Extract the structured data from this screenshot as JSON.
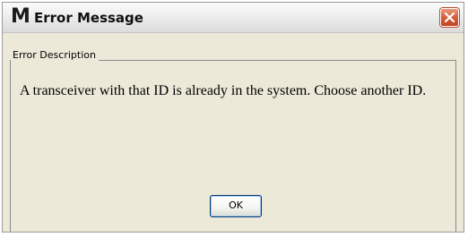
{
  "window": {
    "app_logo": "M",
    "title": "Error Message"
  },
  "group": {
    "legend": "Error Description"
  },
  "message": "A transceiver with that ID is already in the system. Choose another ID.",
  "buttons": {
    "ok_label": "OK"
  },
  "icons": {
    "close": "close-icon"
  },
  "colors": {
    "dialog_background": "#ece9d8",
    "close_button": "#d4603d"
  }
}
